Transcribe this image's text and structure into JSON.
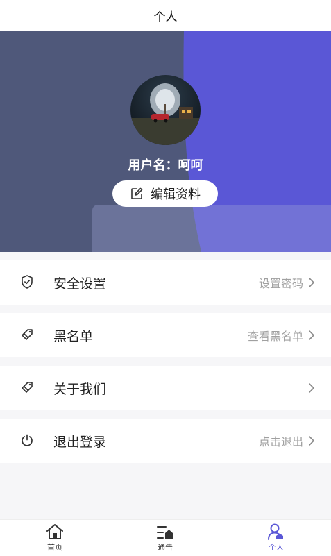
{
  "header": {
    "title": "个人"
  },
  "profile": {
    "username_label": "用户名：",
    "username": "呵呵",
    "edit_label": "编辑资料"
  },
  "menu": [
    {
      "label": "安全设置",
      "value": "设置密码",
      "icon": "shield-check-icon"
    },
    {
      "label": "黑名单",
      "value": "查看黑名单",
      "icon": "tag-icon"
    },
    {
      "label": "关于我们",
      "value": "",
      "icon": "tag-icon"
    },
    {
      "label": "退出登录",
      "value": "点击退出",
      "icon": "power-icon"
    }
  ],
  "tabs": [
    {
      "label": "首页",
      "icon": "home-icon",
      "active": false
    },
    {
      "label": "通告",
      "icon": "notice-icon",
      "active": false
    },
    {
      "label": "个人",
      "icon": "person-icon",
      "active": true
    }
  ],
  "colors": {
    "accent": "#5a57d6",
    "hero_bg": "#4f587a",
    "muted_text": "#a0a0a0"
  }
}
